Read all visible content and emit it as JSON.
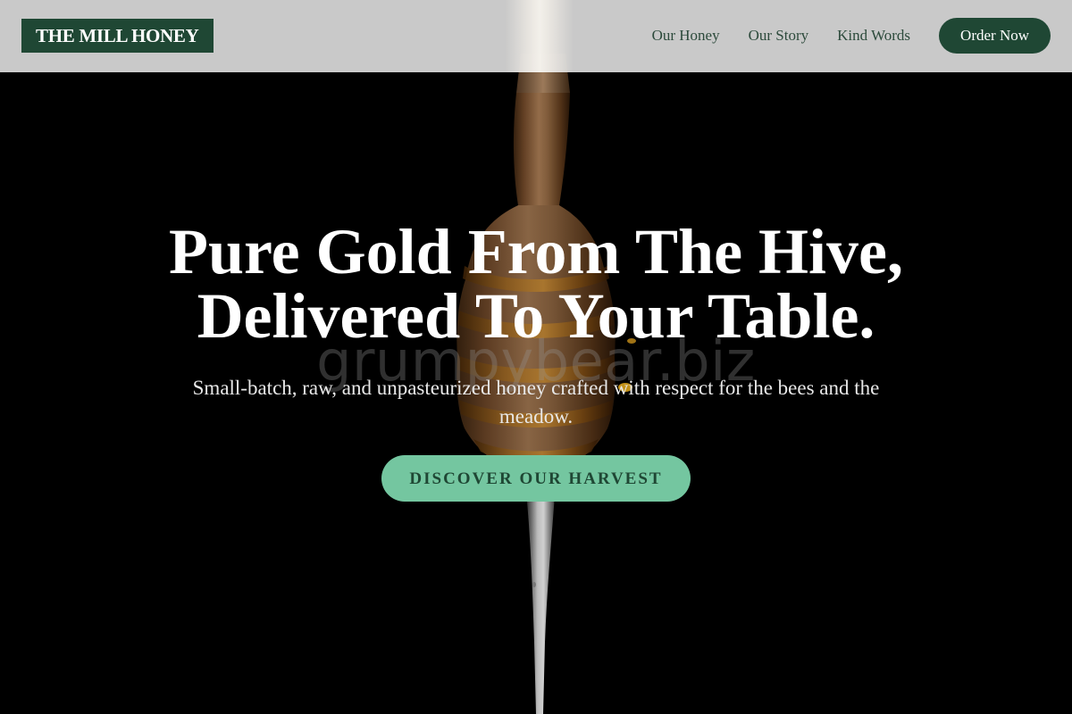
{
  "header": {
    "logo_text": "THE MILL HONEY",
    "nav": [
      {
        "label": "Our Honey"
      },
      {
        "label": "Our Story"
      },
      {
        "label": "Kind Words"
      }
    ],
    "order_button_label": "Order Now"
  },
  "hero": {
    "title_line1": "Pure Gold From The Hive,",
    "title_line2": "Delivered To Your Table.",
    "subtitle": "Small-batch, raw, and unpasteurized honey crafted with respect for the bees and the meadow.",
    "cta_label": "DISCOVER OUR HARVEST",
    "watermark": "grumpybear.biz",
    "background_image": "honey-dipper-image"
  },
  "colors": {
    "brand_green": "#1f4734",
    "cta_green": "#74c6a0",
    "header_bg": "#d6d6d6",
    "hero_bg": "#000000"
  }
}
